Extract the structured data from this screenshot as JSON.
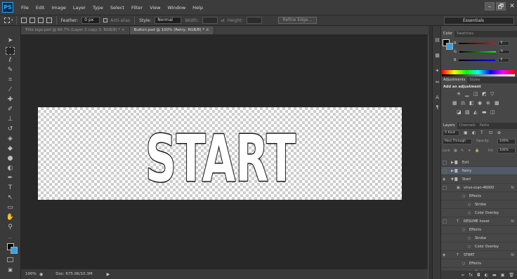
{
  "menubar": {
    "logo": "PS",
    "items": [
      "File",
      "Edit",
      "Image",
      "Layer",
      "Type",
      "Select",
      "Filter",
      "View",
      "Window",
      "Help"
    ],
    "window_controls": [
      "–",
      "🗗",
      "✕"
    ]
  },
  "options": {
    "feather_label": "Feather:",
    "feather_value": "0 px",
    "antialias_label": "Anti-alias",
    "style_label": "Style:",
    "style_value": "Normal",
    "width_label": "Width:",
    "height_label": "Height:",
    "refine_label": "Refine Edge...",
    "workspace": "Essentials"
  },
  "tabs": [
    {
      "label": "Title logo.psd @ 66.7% (Layer 2 copy 3, RGB/8) *",
      "close": "×"
    },
    {
      "label": "Button.psd @ 100% (Retry, RGB/8) *",
      "close": "×"
    }
  ],
  "canvas": {
    "text": "START"
  },
  "status": {
    "zoom": "100%",
    "doc": "Doc: 675.0K/10.3M",
    "arrow": "▶"
  },
  "color_panel": {
    "tabs": [
      "Color",
      "Swatches"
    ],
    "r_label": "R",
    "g_label": "G",
    "b_label": "B",
    "r": "0",
    "g": "0",
    "b": "0"
  },
  "adjustments_panel": {
    "tabs": [
      "Adjustments",
      "Styles"
    ],
    "heading": "Add an adjustment"
  },
  "layers_panel": {
    "tabs": [
      "Layers",
      "Channels",
      "Paths"
    ],
    "kind": "Kind",
    "blend": "Pass Through",
    "opacity_label": "Opacity:",
    "opacity": "100%",
    "lock_label": "Lock:",
    "fill_label": "Fill:",
    "fill": "100%",
    "rows": [
      {
        "name": "Exit",
        "type": "group",
        "indent": 0,
        "selected": false,
        "eye": false
      },
      {
        "name": "Retry",
        "type": "group",
        "indent": 0,
        "selected": true,
        "eye": false
      },
      {
        "name": "Start",
        "type": "group-open",
        "indent": 0,
        "selected": false,
        "eye": true
      },
      {
        "name": "virus-scan-46000",
        "type": "smart",
        "indent": 1,
        "selected": false,
        "eye": false,
        "fx": "fx"
      },
      {
        "name": "Effects",
        "type": "effects",
        "indent": 2
      },
      {
        "name": "Stroke",
        "type": "effect",
        "indent": 3
      },
      {
        "name": "Color Overlay",
        "type": "effect",
        "indent": 3
      },
      {
        "name": "RESUME hover",
        "type": "text",
        "indent": 1,
        "selected": false,
        "eye": false,
        "fx": "fx"
      },
      {
        "name": "Effects",
        "type": "effects",
        "indent": 2
      },
      {
        "name": "Stroke",
        "type": "effect",
        "indent": 3
      },
      {
        "name": "Color Overlay",
        "type": "effect",
        "indent": 3
      },
      {
        "name": "START",
        "type": "text",
        "indent": 1,
        "selected": false,
        "eye": true,
        "fx": "fx"
      },
      {
        "name": "Effects",
        "type": "effects",
        "indent": 2
      },
      {
        "name": "Stroke",
        "type": "effect",
        "indent": 3
      }
    ]
  },
  "colors": {
    "accent": "#31a8ff",
    "fg": "#000000",
    "bg": "#2fa4e7"
  }
}
